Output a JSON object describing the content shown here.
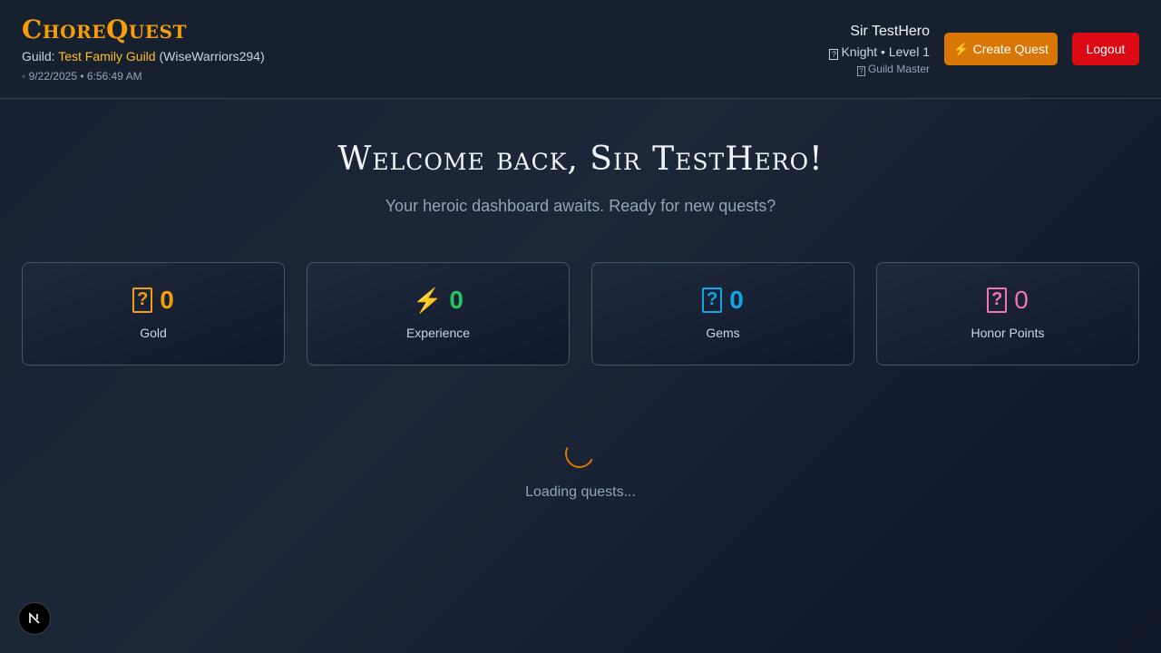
{
  "header": {
    "brand": "ChoreQuest",
    "guild_prefix": "Guild:",
    "guild_name": "Test Family Guild",
    "guild_code": "(WiseWarriors294)",
    "date_icon": "clock-icon",
    "datetime": "9/22/2025 • 6:56:49 AM",
    "user_name": "Sir TestHero",
    "user_class": "Knight • Level 1",
    "user_role": "Guild Master",
    "create_button": "Create Quest",
    "create_icon": "lightning-icon",
    "logout_button": "Logout"
  },
  "main": {
    "welcome": "Welcome back, Sir TestHero!",
    "subtitle": "Your heroic dashboard awaits. Ready for new quests?",
    "loading_text": "Loading quests..."
  },
  "stats": [
    {
      "label": "Gold",
      "value": "0",
      "color": "#f59e0b",
      "icon": "gold-icon"
    },
    {
      "label": "Experience",
      "value": "0",
      "color": "#22c55e",
      "icon": "lightning-icon"
    },
    {
      "label": "Gems",
      "value": "0",
      "color": "#0ea5e9",
      "icon": "gem-icon"
    },
    {
      "label": "Honor Points",
      "value": "0",
      "color": "#f472b6",
      "icon": "honor-icon"
    }
  ],
  "colors": {
    "accent": "#d97706",
    "logout": "#dc0a15",
    "background": "#1c2738"
  }
}
